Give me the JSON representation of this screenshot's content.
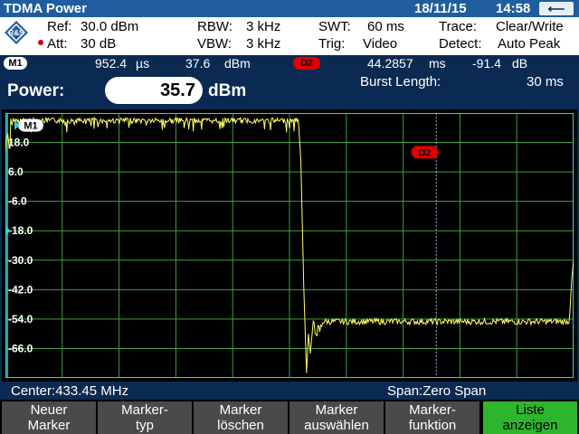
{
  "titlebar": {
    "app_title": "TDMA Power",
    "date": "18/11/15",
    "time": "14:58",
    "back_label": "⟵"
  },
  "settings": {
    "ref_label": "Ref:",
    "ref_value": "30.0 dBm",
    "att_label": "Att:",
    "att_value": "30 dB",
    "rbw_label": "RBW:",
    "rbw_value": "3 kHz",
    "vbw_label": "VBW:",
    "vbw_value": "3 kHz",
    "swt_label": "SWT:",
    "swt_value": "60 ms",
    "trig_label": "Trig:",
    "trig_value": "Video",
    "trace_label": "Trace:",
    "trace_value": "Clear/Write",
    "detect_label": "Detect:",
    "detect_value": "Auto Peak"
  },
  "markers": {
    "m1_label": "M1",
    "m1_time": "952.4",
    "m1_time_unit": "µs",
    "m1_level": "37.6",
    "m1_level_unit": "dBm",
    "d2_label": "D2",
    "d2_time": "44.2857",
    "d2_time_unit": "ms",
    "d2_level": "-91.4",
    "d2_level_unit": "dB"
  },
  "measurement": {
    "power_label": "Power:",
    "power_value": "35.7",
    "power_unit": "dBm",
    "burst_label": "Burst Length:",
    "burst_value": "30 ms"
  },
  "chart_data": {
    "type": "line",
    "y_ticks": [
      "18.0",
      "6.0",
      "-6.0",
      "-18.0",
      "-30.0",
      "-42.0",
      "-54.0",
      "-66.0"
    ],
    "ylim": [
      -78,
      30
    ],
    "x_range_ms": [
      0,
      60
    ],
    "grid": true,
    "series": [
      {
        "segments": [
          {
            "x": [
              0,
              31
            ],
            "y": 28
          },
          {
            "x": [
              31.8,
              60
            ],
            "y": -54
          }
        ]
      }
    ],
    "markers": [
      {
        "label": "M1",
        "x": 0.9524,
        "y": 25
      },
      {
        "label": "D2",
        "x": 44.2857,
        "y": 14
      }
    ],
    "marker_line_x": 45.5
  },
  "footer": {
    "center": "Center:433.45 MHz",
    "span": "Span:Zero Span"
  },
  "softkeys": [
    {
      "line1": "Neuer",
      "line2": "Marker"
    },
    {
      "line1": "Marker-",
      "line2": "typ"
    },
    {
      "line1": "Marker",
      "line2": "löschen"
    },
    {
      "line1": "Marker",
      "line2": "auswählen"
    },
    {
      "line1": "Marker-",
      "line2": "funktion"
    },
    {
      "line1": "Liste",
      "line2": "anzeigen"
    }
  ],
  "colors": {
    "trace": "#ffff66",
    "grid": "#3fa03f",
    "frame": "#33d3d3",
    "background": "#0b2a52",
    "active_key": "#2db52d",
    "marker_d2": "#e20000"
  }
}
